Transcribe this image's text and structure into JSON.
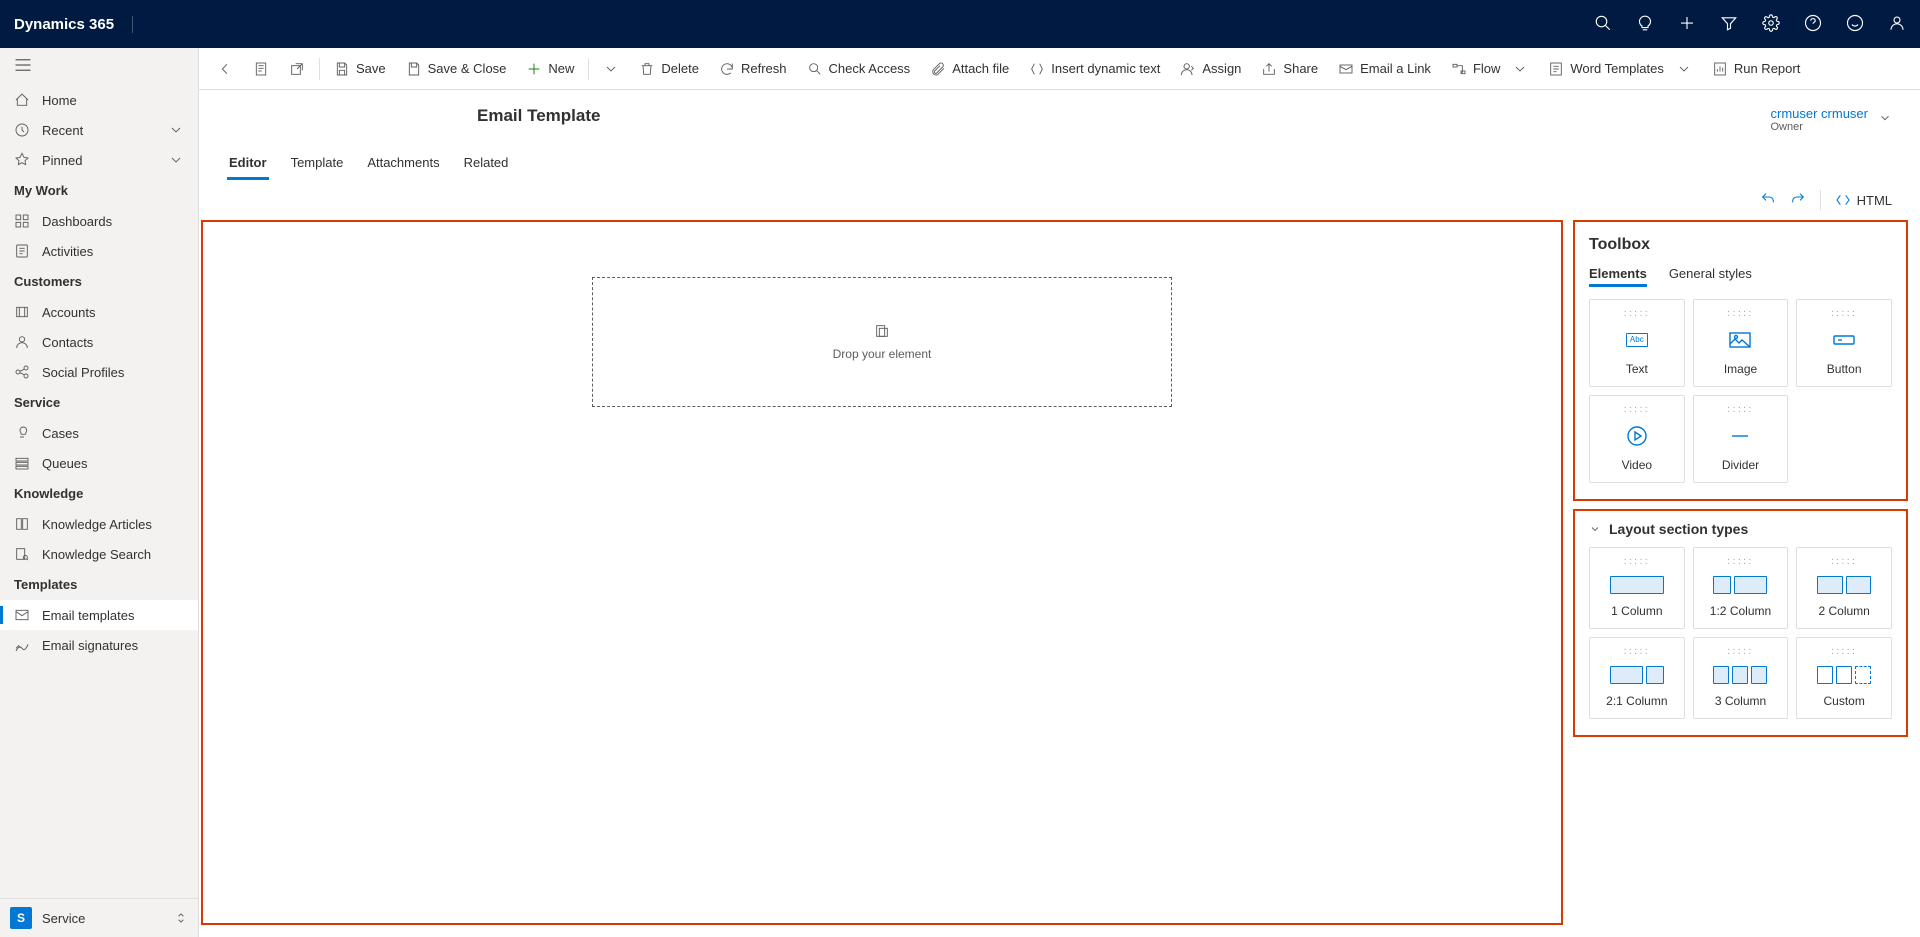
{
  "brand": "Dynamics 365",
  "owner": {
    "name": "crmuser crmuser",
    "label": "Owner"
  },
  "page_title": "Email Template",
  "commands": {
    "save": "Save",
    "save_close": "Save & Close",
    "new": "New",
    "delete": "Delete",
    "refresh": "Refresh",
    "check_access": "Check Access",
    "attach_file": "Attach file",
    "insert_dynamic": "Insert dynamic text",
    "assign": "Assign",
    "share": "Share",
    "email_link": "Email a Link",
    "flow": "Flow",
    "word_templates": "Word Templates",
    "run_report": "Run Report"
  },
  "tabs": {
    "editor": "Editor",
    "template": "Template",
    "attachments": "Attachments",
    "related": "Related"
  },
  "editor_actions": {
    "html": "HTML"
  },
  "sidebar": {
    "home": "Home",
    "recent": "Recent",
    "pinned": "Pinned",
    "my_work": "My Work",
    "dashboards": "Dashboards",
    "activities": "Activities",
    "customers": "Customers",
    "accounts": "Accounts",
    "contacts": "Contacts",
    "social": "Social Profiles",
    "service": "Service",
    "cases": "Cases",
    "queues": "Queues",
    "knowledge": "Knowledge",
    "articles": "Knowledge Articles",
    "search": "Knowledge Search",
    "templates": "Templates",
    "email_templates": "Email templates",
    "email_signatures": "Email signatures",
    "bottom_label": "Service",
    "bottom_initial": "S"
  },
  "canvas": {
    "drop": "Drop your element"
  },
  "toolbox": {
    "title": "Toolbox",
    "tabs": {
      "elements": "Elements",
      "styles": "General styles"
    },
    "elements": {
      "text": "Text",
      "image": "Image",
      "button": "Button",
      "video": "Video",
      "divider": "Divider"
    }
  },
  "layout": {
    "title": "Layout section types",
    "col1": "1 Column",
    "col12": "1:2 Column",
    "col2": "2 Column",
    "col21": "2:1 Column",
    "col3": "3 Column",
    "custom": "Custom"
  }
}
